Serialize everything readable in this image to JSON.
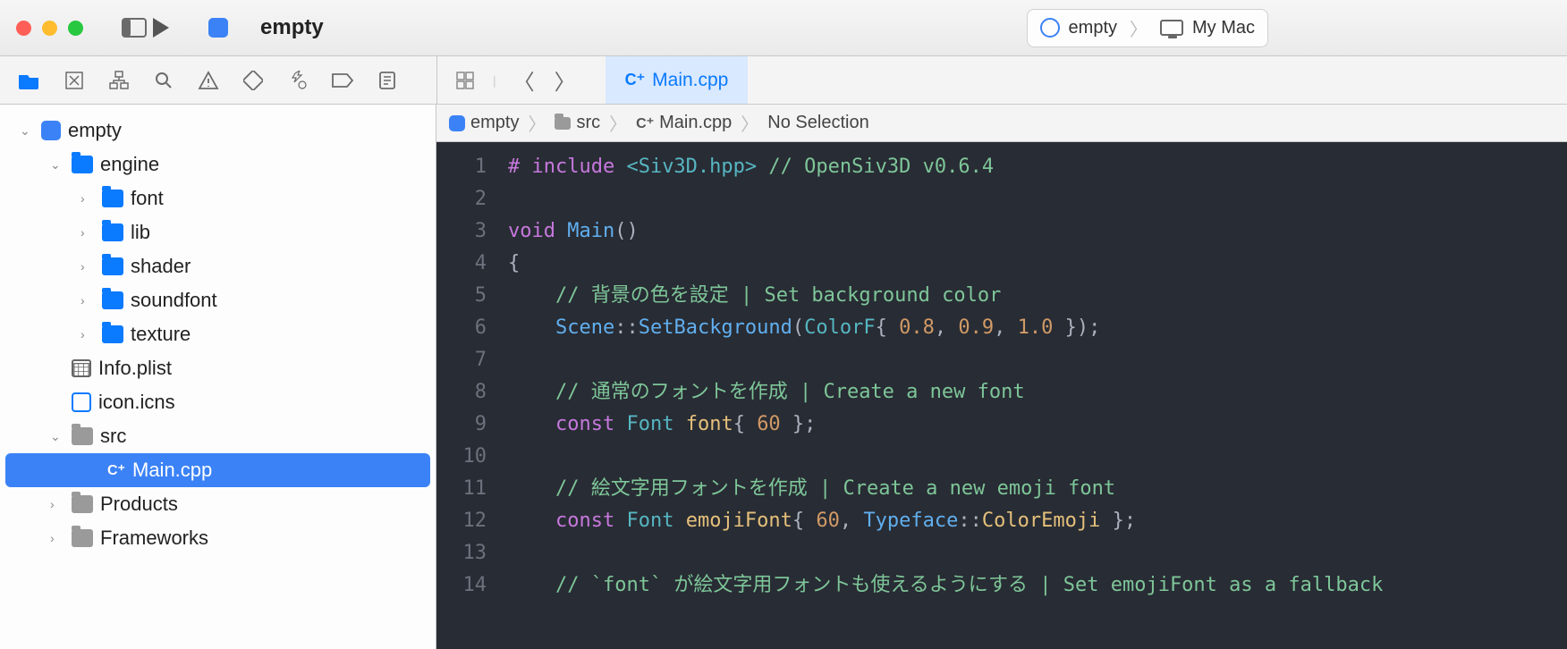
{
  "titlebar": {
    "scheme_name": "empty",
    "target_scheme": "empty",
    "target_device": "My Mac"
  },
  "toolbar_icons": [
    "folder",
    "navigator-2",
    "hierarchy",
    "search",
    "warnings",
    "diamond",
    "spray",
    "tag",
    "list"
  ],
  "tab": {
    "label": "Main.cpp",
    "badge": "C⁺"
  },
  "breadcrumb": {
    "project": "empty",
    "folder": "src",
    "file": "Main.cpp",
    "selection": "No Selection",
    "file_badge": "C⁺"
  },
  "sidebar": {
    "tree": [
      {
        "depth": 0,
        "disclosure": "down",
        "icon": "app",
        "label": "empty"
      },
      {
        "depth": 1,
        "disclosure": "down",
        "icon": "folder",
        "label": "engine"
      },
      {
        "depth": 2,
        "disclosure": "right",
        "icon": "folder",
        "label": "font"
      },
      {
        "depth": 2,
        "disclosure": "right",
        "icon": "folder",
        "label": "lib"
      },
      {
        "depth": 2,
        "disclosure": "right",
        "icon": "folder",
        "label": "shader"
      },
      {
        "depth": 2,
        "disclosure": "right",
        "icon": "folder",
        "label": "soundfont"
      },
      {
        "depth": 2,
        "disclosure": "right",
        "icon": "folder",
        "label": "texture"
      },
      {
        "depth": 1,
        "disclosure": "",
        "icon": "plist",
        "label": "Info.plist"
      },
      {
        "depth": 1,
        "disclosure": "",
        "icon": "icns",
        "label": "icon.icns"
      },
      {
        "depth": 1,
        "disclosure": "down",
        "icon": "folder-gray",
        "label": "src"
      },
      {
        "depth": 2,
        "disclosure": "",
        "icon": "cpp",
        "label": "Main.cpp",
        "selected": true,
        "badge": "C⁺"
      },
      {
        "depth": 1,
        "disclosure": "right",
        "icon": "folder-gray",
        "label": "Products"
      },
      {
        "depth": 1,
        "disclosure": "right",
        "icon": "folder-gray",
        "label": "Frameworks"
      }
    ]
  },
  "code": {
    "lines": [
      {
        "n": 1,
        "tokens": [
          [
            "pre",
            "# include "
          ],
          [
            "incpath",
            "<Siv3D.hpp>"
          ],
          [
            "punct",
            " "
          ],
          [
            "comment",
            "// OpenSiv3D v0.6.4"
          ]
        ]
      },
      {
        "n": 2,
        "tokens": []
      },
      {
        "n": 3,
        "tokens": [
          [
            "kw",
            "void "
          ],
          [
            "fn",
            "Main"
          ],
          [
            "punct",
            "()"
          ]
        ]
      },
      {
        "n": 4,
        "tokens": [
          [
            "punct",
            "{"
          ]
        ]
      },
      {
        "n": 5,
        "tokens": [
          [
            "punct",
            "    "
          ],
          [
            "comment",
            "// 背景の色を設定 | Set background color"
          ]
        ]
      },
      {
        "n": 6,
        "tokens": [
          [
            "punct",
            "    "
          ],
          [
            "ns",
            "Scene"
          ],
          [
            "punct",
            "::"
          ],
          [
            "fn",
            "SetBackground"
          ],
          [
            "punct",
            "("
          ],
          [
            "type",
            "ColorF"
          ],
          [
            "punct",
            "{ "
          ],
          [
            "num",
            "0.8"
          ],
          [
            "punct",
            ", "
          ],
          [
            "num",
            "0.9"
          ],
          [
            "punct",
            ", "
          ],
          [
            "num",
            "1.0"
          ],
          [
            "punct",
            " });"
          ]
        ]
      },
      {
        "n": 7,
        "tokens": []
      },
      {
        "n": 8,
        "tokens": [
          [
            "punct",
            "    "
          ],
          [
            "comment",
            "// 通常のフォントを作成 | Create a new font"
          ]
        ]
      },
      {
        "n": 9,
        "tokens": [
          [
            "punct",
            "    "
          ],
          [
            "kw",
            "const "
          ],
          [
            "type",
            "Font "
          ],
          [
            "ident",
            "font"
          ],
          [
            "punct",
            "{ "
          ],
          [
            "num",
            "60"
          ],
          [
            "punct",
            " };"
          ]
        ]
      },
      {
        "n": 10,
        "tokens": []
      },
      {
        "n": 11,
        "tokens": [
          [
            "punct",
            "    "
          ],
          [
            "comment",
            "// 絵文字用フォントを作成 | Create a new emoji font"
          ]
        ]
      },
      {
        "n": 12,
        "tokens": [
          [
            "punct",
            "    "
          ],
          [
            "kw",
            "const "
          ],
          [
            "type",
            "Font "
          ],
          [
            "ident",
            "emojiFont"
          ],
          [
            "punct",
            "{ "
          ],
          [
            "num",
            "60"
          ],
          [
            "punct",
            ", "
          ],
          [
            "ns",
            "Typeface"
          ],
          [
            "punct",
            "::"
          ],
          [
            "ident",
            "ColorEmoji"
          ],
          [
            "punct",
            " };"
          ]
        ]
      },
      {
        "n": 13,
        "tokens": []
      },
      {
        "n": 14,
        "tokens": [
          [
            "punct",
            "    "
          ],
          [
            "comment",
            "// `font` が絵文字用フォントも使えるようにする | Set emojiFont as a fallback"
          ]
        ]
      }
    ]
  }
}
